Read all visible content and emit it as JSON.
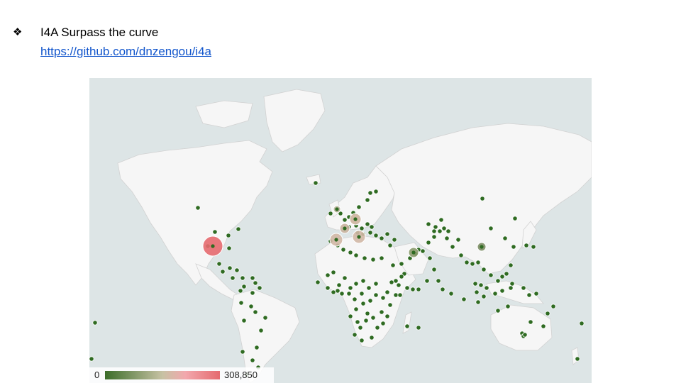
{
  "slide": {
    "bullet_icon": "diamond-bullet-icon",
    "title": "I4A Surpass the curve",
    "link": "https://github.com/dnzengou/i4a"
  },
  "map": {
    "type": "bubble-map",
    "legend": {
      "min_label": "0",
      "max_label": "308,850",
      "min_color": "#3b6d29",
      "mid_color": "#c7c2a4",
      "max_color": "#e56a6f"
    },
    "colors": {
      "ocean": "#dde5e6",
      "land": "#f6f6f6",
      "border": "#d2d2d2"
    },
    "large_bubbles": [
      {
        "region": "United States",
        "value": 308850,
        "color": "#e56a6f"
      },
      {
        "region": "Spain",
        "value": 120000,
        "color": "#d2b8a6"
      },
      {
        "region": "Italy",
        "value": 120000,
        "color": "#d2b8a6"
      },
      {
        "region": "Germany",
        "value": 90000,
        "color": "#cdb59f"
      },
      {
        "region": "France",
        "value": 80000,
        "color": "#c9b39e"
      },
      {
        "region": "United Kingdom",
        "value": 40000,
        "color": "#b8b49a"
      },
      {
        "region": "Iran",
        "value": 50000,
        "color": "#8a9a6b"
      },
      {
        "region": "China",
        "value": 82000,
        "color": "#7d8e66"
      }
    ]
  }
}
